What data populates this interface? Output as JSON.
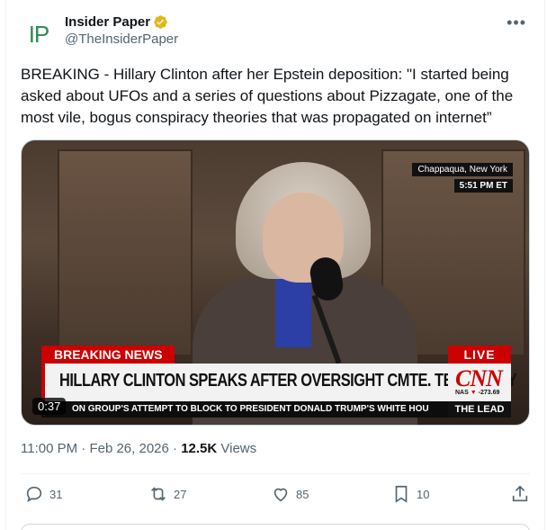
{
  "account": {
    "display_name": "Insider Paper",
    "handle": "@TheInsiderPaper",
    "avatar_text": "IP"
  },
  "tweet": {
    "text": "BREAKING - Hillary Clinton after her Epstein deposition: \"I started being asked about UFOs and a series of questions about Pizzagate, one of the most vile, bogus conspiracy theories that was propagated on internet”"
  },
  "video": {
    "location": "Chappaqua, New York",
    "time": "5:51 PM ET",
    "breaking_label": "BREAKING NEWS",
    "live_label": "LIVE",
    "headline": "HILLARY CLINTON SPEAKS AFTER OVERSIGHT CMTE. TESTIMONY",
    "network": "CNN",
    "market_label": "NAS",
    "market_change": "-273.69",
    "ticker": "ON GROUP'S ATTEMPT TO BLOCK TO PRESIDENT DONALD TRUMP'S WHITE HOU",
    "show_name": "THE LEAD",
    "duration": "0:37"
  },
  "meta": {
    "time": "11:00 PM",
    "date": "Feb 26, 2026",
    "views_count": "12.5K",
    "views_label": "Views"
  },
  "actions": {
    "replies": "31",
    "reposts": "27",
    "likes": "85",
    "bookmarks": "10"
  },
  "colors": {
    "verified_gold": "#e2b719",
    "breaking_red": "#cc0000",
    "text_secondary": "#536471"
  }
}
